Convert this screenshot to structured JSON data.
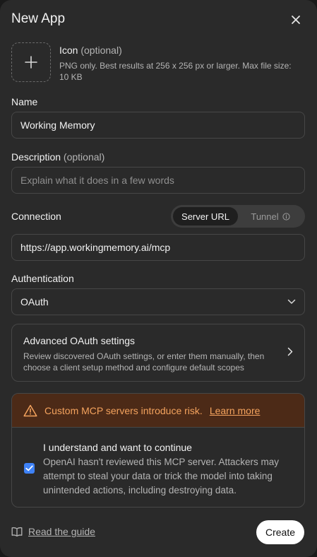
{
  "dialog": {
    "title": "New App"
  },
  "icon_section": {
    "label": "Icon",
    "optional": "(optional)",
    "hint": "PNG only. Best results at 256 x 256 px or larger. Max file size: 10 KB"
  },
  "name": {
    "label": "Name",
    "value": "Working Memory"
  },
  "description": {
    "label": "Description",
    "optional": "(optional)",
    "placeholder": "Explain what it does in a few words"
  },
  "connection": {
    "label": "Connection",
    "options": [
      "Server URL",
      "Tunnel"
    ],
    "selected": "Server URL",
    "url": "https://app.workingmemory.ai/mcp"
  },
  "authentication": {
    "label": "Authentication",
    "value": "OAuth"
  },
  "advanced": {
    "title": "Advanced OAuth settings",
    "description": "Review discovered OAuth settings, or enter them manually, then choose a client setup method and configure default scopes"
  },
  "risk": {
    "warning": "Custom MCP servers introduce risk.",
    "link": "Learn more",
    "ack_title": "I understand and want to continue",
    "ack_description": "OpenAI hasn't reviewed this MCP server. Attackers may attempt to steal your data or trick the model into taking unintended actions, including destroying data.",
    "checked": true
  },
  "footer": {
    "guide": "Read the guide",
    "create": "Create"
  },
  "icons": [
    "close-icon",
    "plus-icon",
    "info-icon",
    "chevron-down-icon",
    "chevron-right-icon",
    "warning-icon",
    "check-icon",
    "book-icon"
  ],
  "colors": {
    "accent": "#3e82f7",
    "warning_text": "#f4a35e",
    "warning_bg": "#4c2a17"
  }
}
